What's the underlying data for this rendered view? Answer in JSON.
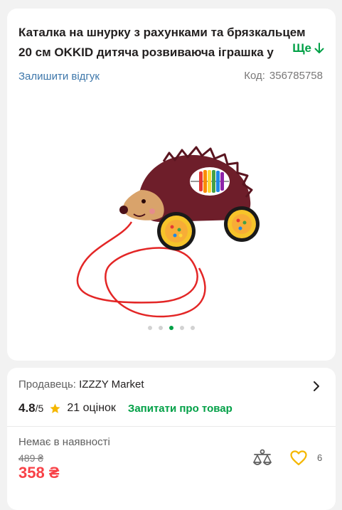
{
  "product": {
    "title_line1": "Каталка на шнурку з рахунками та брязкальцем",
    "title_line2": "20 см OKKID дитяча розвиваюча іграшка у",
    "more_label": "Ще",
    "review_link": "Залишити відгук",
    "code_label": "Код:",
    "code_value": "356785758",
    "gallery": {
      "dot_count": 5,
      "active_index": 2
    }
  },
  "seller": {
    "label": "Продавець:",
    "name": "IZZZY Market"
  },
  "rating": {
    "value": "4.8",
    "max": "/5",
    "count": "21 оцінок",
    "ask_link": "Запитати про товар"
  },
  "availability": {
    "status": "Немає в наявності",
    "old_price": "489 ₴",
    "price": "358 ₴",
    "wishlist_count": "6"
  },
  "colors": {
    "accent_green": "#00a046",
    "link_blue": "#3e77aa",
    "price_red": "#f84147",
    "wishlist_yellow": "#f5b700"
  }
}
